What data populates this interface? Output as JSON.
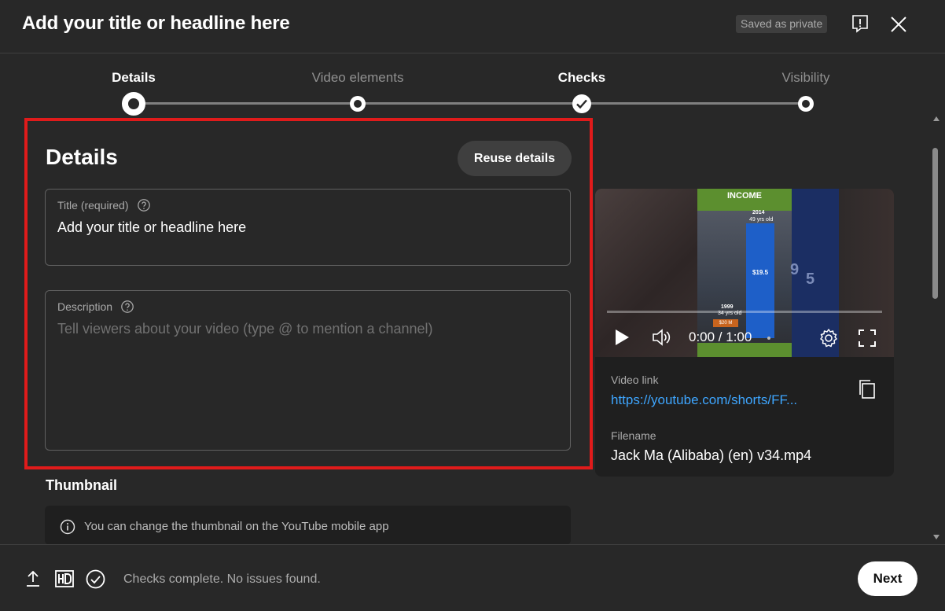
{
  "header": {
    "title": "Add your title or headline here",
    "saved_status": "Saved as private"
  },
  "stepper": {
    "steps": [
      {
        "label": "Details",
        "state": "current"
      },
      {
        "label": "Video elements",
        "state": "pending"
      },
      {
        "label": "Checks",
        "state": "complete"
      },
      {
        "label": "Visibility",
        "state": "pending"
      }
    ]
  },
  "details": {
    "heading": "Details",
    "reuse_button": "Reuse details",
    "title_field": {
      "label": "Title (required)",
      "value": "Add your title or headline here"
    },
    "description_field": {
      "label": "Description",
      "placeholder": "Tell viewers about your video (type @ to mention a channel)"
    }
  },
  "thumbnail": {
    "heading": "Thumbnail",
    "info": "You can change the thumbnail on the YouTube mobile app"
  },
  "video": {
    "thumbnail_texts": {
      "banner": "INCOME",
      "year_top": "2014",
      "age_top": "49 yrs old",
      "year_bottom": "1999",
      "age_bottom": "34 yrs old",
      "amount_small": "$20 M",
      "bar_value": "$19.5",
      "big_digit_1": "9",
      "big_digit_2": "5"
    },
    "player": {
      "time": "0:00 / 1:00",
      "progress": 0
    },
    "link_label": "Video link",
    "link_url": "https://youtube.com/shorts/FF...",
    "filename_label": "Filename",
    "filename": "Jack Ma (Alibaba) (en) v34.mp4"
  },
  "footer": {
    "status": "Checks complete. No issues found.",
    "next_button": "Next"
  }
}
